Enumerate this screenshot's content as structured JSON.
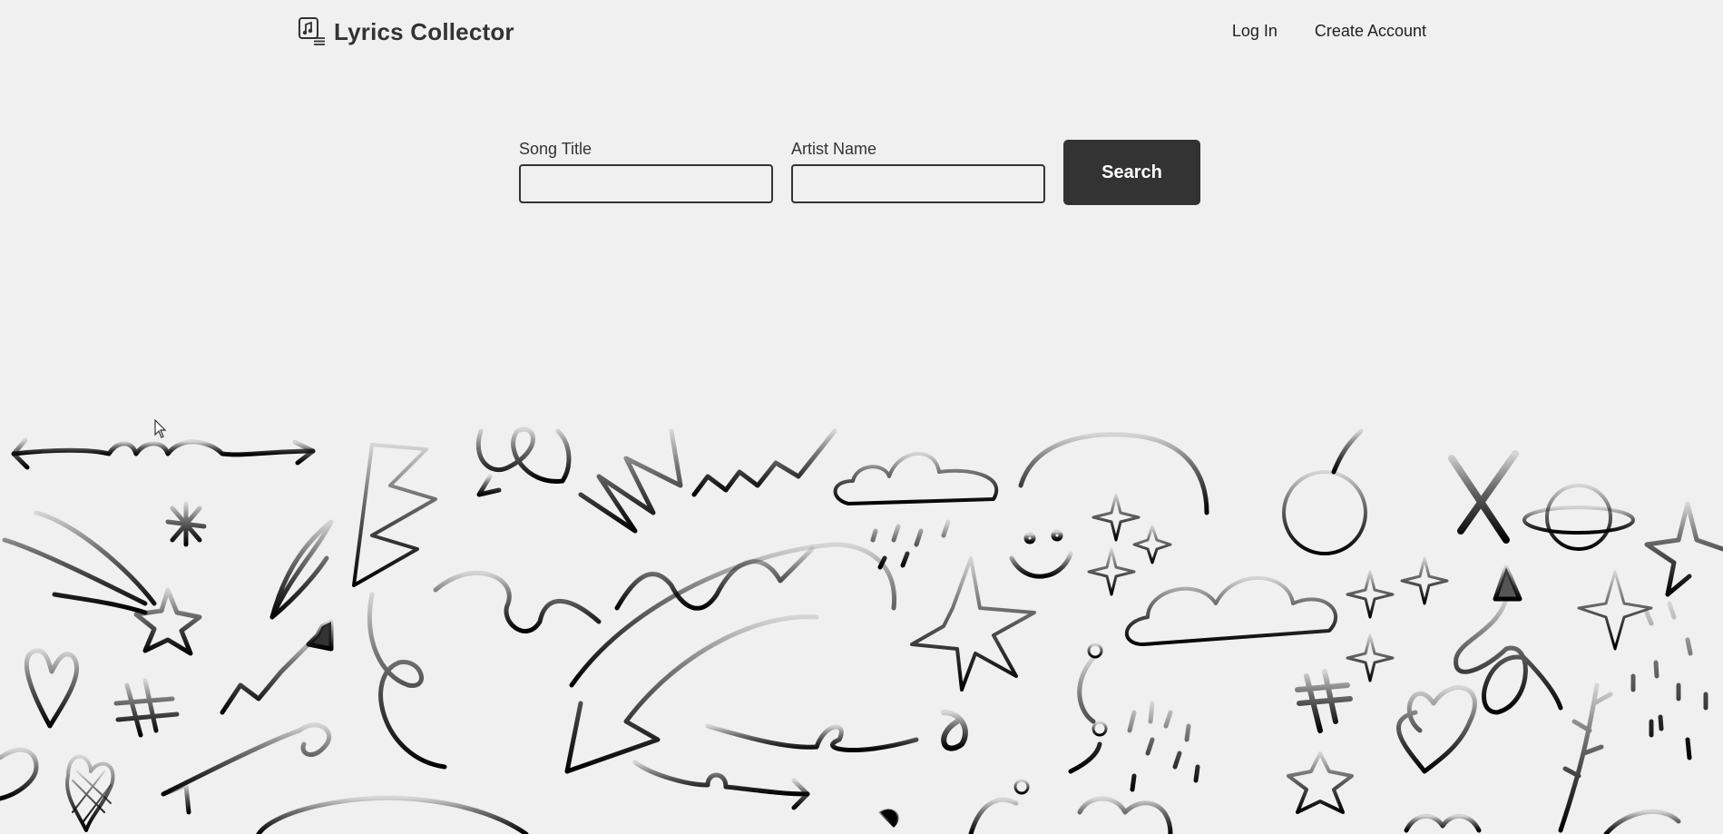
{
  "header": {
    "brand_title": "Lyrics Collector",
    "brand_icon": "music-note-list-icon",
    "nav": {
      "login_label": "Log In",
      "create_account_label": "Create Account"
    }
  },
  "search": {
    "song_title_label": "Song Title",
    "song_title_value": "",
    "artist_name_label": "Artist Name",
    "artist_name_value": "",
    "button_label": "Search"
  },
  "decoration": {
    "background_icon": "hand-drawn-doodles-illustration",
    "colors": {
      "background": "#f0f0f0",
      "text": "#333333",
      "button_bg": "#333333",
      "button_text": "#ffffff"
    }
  }
}
